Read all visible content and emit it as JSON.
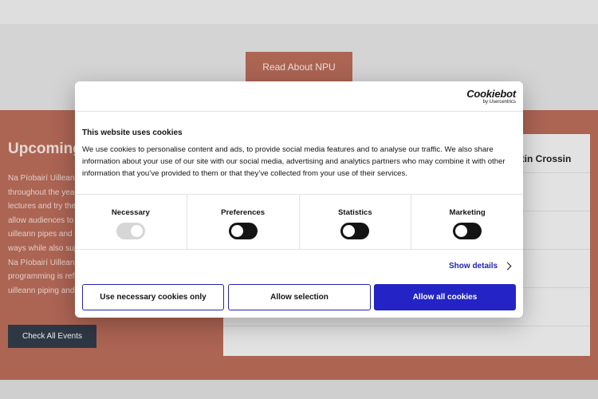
{
  "page": {
    "read_npu_label": "Read About NPU",
    "events_heading": "Upcoming",
    "events_text_lines": [
      "Na Píobairí Uilleann",
      "throughout the year",
      "lectures and try the",
      "allow audiences to",
      "uilleann pipes and t",
      "ways while also sup",
      "Na Píobairí Uilleann",
      "programming is refl",
      "uilleann piping and"
    ],
    "check_events_label": "Check All Events",
    "event_title_fragment": "rtin Crossin"
  },
  "cookie_dialog": {
    "logo_main": "Cookiebot",
    "logo_sub": "by Usercentrics",
    "title": "This website uses cookies",
    "body": "We use cookies to personalise content and ads, to provide social media features and to analyse our traffic. We also share information about your use of our site with our social media, advertising and analytics partners who may combine it with other information that you’ve provided to them or that they’ve collected from your use of their services.",
    "categories": [
      {
        "label": "Necessary",
        "enabled": true,
        "locked": true
      },
      {
        "label": "Preferences",
        "enabled": false,
        "locked": false
      },
      {
        "label": "Statistics",
        "enabled": false,
        "locked": false
      },
      {
        "label": "Marketing",
        "enabled": false,
        "locked": false
      }
    ],
    "show_details_label": "Show details",
    "buttons": {
      "necessary_only": "Use necessary cookies only",
      "allow_selection": "Allow selection",
      "allow_all": "Allow all cookies"
    }
  },
  "colors": {
    "brand_terracotta": "#b86a57",
    "dark_button": "#2f3a47",
    "cookie_accent": "#2323c6",
    "link_blue": "#2323b4"
  }
}
